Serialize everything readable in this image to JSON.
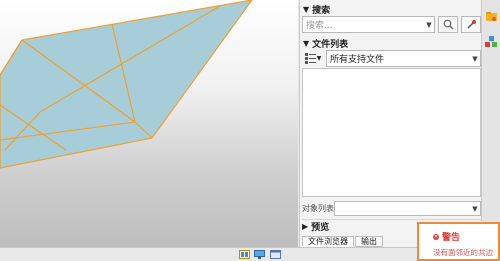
{
  "search": {
    "title": "搜索",
    "placeholder": "搜索..."
  },
  "file_list": {
    "title": "文件列表",
    "filter_value": "所有支持文件"
  },
  "object_list": {
    "label": "对象列表"
  },
  "preview": {
    "title": "预览"
  },
  "tabs": [
    {
      "label": "文件浏览器",
      "active": true
    },
    {
      "label": "输出",
      "active": false
    }
  ],
  "warning": {
    "title": "警告",
    "message": "没有面邻近的共边"
  },
  "colors": {
    "mesh_fill": "#a7cdd9",
    "mesh_edges": "#f0a030",
    "warning_border": "#f08a3a",
    "warning_text": "#e43b3b"
  },
  "icons": {
    "search_clear": "magnifier-icon",
    "search_tool": "eyedropper-icon",
    "right_top": "folder-icon",
    "right_second": "cubes-icon"
  }
}
